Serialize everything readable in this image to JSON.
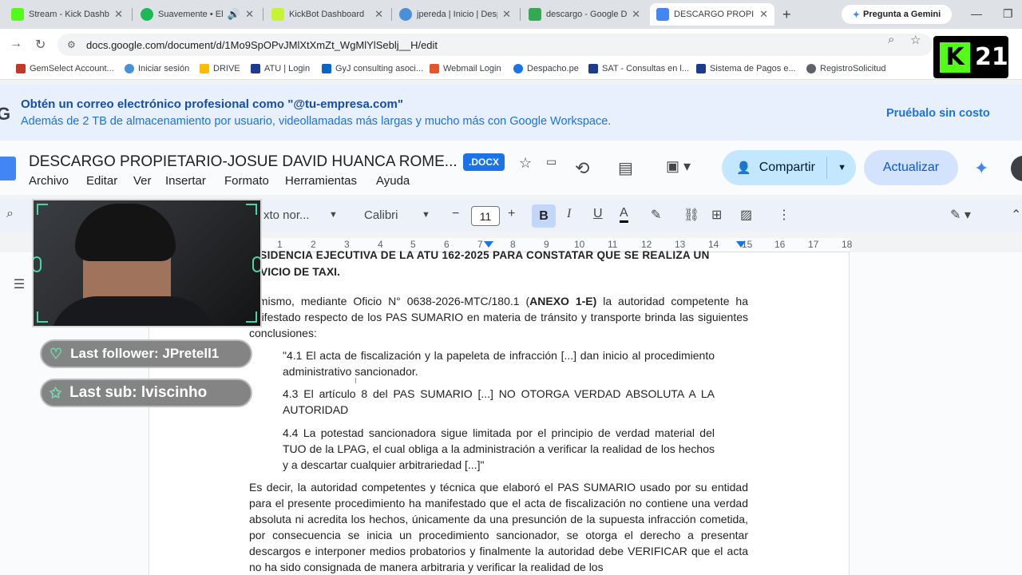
{
  "browser": {
    "tabs": [
      {
        "title": "Stream - Kick Dashbo",
        "icon": "kick-icon",
        "color": "#53fc18"
      },
      {
        "title": "Suavemente • Elv",
        "icon": "spotify-icon",
        "color": "#1db954"
      },
      {
        "title": "KickBot Dashboard",
        "icon": "kickbot-icon",
        "color": "#c6f432"
      },
      {
        "title": "jpereda | Inicio | Desp",
        "icon": "globe-icon",
        "color": "#4a90d9"
      },
      {
        "title": "descargo - Google D",
        "icon": "drive-icon",
        "color": "#34a853"
      },
      {
        "title": "DESCARGO PROPIET",
        "icon": "docs-icon",
        "color": "#4285f4"
      }
    ],
    "gemini_button": "Pregunta a Gemini",
    "url": "docs.google.com/document/d/1Mo9SpOPvJMlXtXmZt_WgMlYlSeblj__H/edit",
    "bookmarks": [
      "GemSelect Account...",
      "Iniciar sesión",
      "DRIVE",
      "ATU | Login",
      "GyJ consulting asoci...",
      "Webmail Login",
      "Despacho.pe",
      "SAT - Consultas en l...",
      "Sistema de Pagos e...",
      "RegistroSolicitud"
    ]
  },
  "promo": {
    "title": "Obtén un correo electrónico profesional como \"@tu-empresa.com\"",
    "subtitle": "Además de 2 TB de almacenamiento por usuario, videollamadas más largas y mucho más con Google Workspace.",
    "cta": "Pruébalo sin costo"
  },
  "docs": {
    "title": "DESCARGO PROPIETARIO-JOSUE DAVID HUANCA ROME...",
    "badge": ".DOCX",
    "menu": [
      "Archivo",
      "Editar",
      "Ver",
      "Insertar",
      "Formato",
      "Herramientas",
      "Ayuda"
    ],
    "share_label": "Compartir",
    "update_label": "Actualizar",
    "toolbar": {
      "style": "xto nor...",
      "font": "Calibri",
      "font_size": "11"
    },
    "ruler": [
      "1",
      "2",
      "3",
      "4",
      "5",
      "6",
      "7",
      "8",
      "9",
      "10",
      "11",
      "12",
      "13",
      "14",
      "15",
      "16",
      "17",
      "18"
    ]
  },
  "document": {
    "heading_line1": "ESIDENCIA EJECUTIVA DE LA ATU 162-2025 PARA CONSTATAR QUE SE REALIZA UN",
    "heading_line2": "RVICIO DE TAXI.",
    "para1_pre": "í mismo, mediante Oficio N° 0638-2026-MTC/180.1 (",
    "para1_bold": "ANEXO 1-E)",
    "para1_post": " la autoridad competente ha anifestado respecto de los PAS SUMARIO en materia de tránsito y transporte brinda las siguientes conclusiones:",
    "quote1": "\"4.1 El acta de fiscalización y la papeleta de infracción [...] dan inicio al procedimiento administrativo sancionador.",
    "quote2": "4.3 El artículo 8 del PAS SUMARIO [...] NO OTORGA VERDAD ABSOLUTA A LA AUTORIDAD",
    "quote3": "4.4 La potestad sancionadora sigue limitada por el principio de verdad material del TUO de la LPAG, el cual obliga a la administración a verificar la realidad de los hechos y a descartar cualquier arbitrariedad [...]\"",
    "para2": "Es decir, la autoridad competentes y técnica que elaboró el PAS SUMARIO usado por su entidad para el presente procedimiento ha manifestado que el acta de fiscalización no contiene una verdad absoluta ni acredita los hechos, únicamente da una presunción de la supuesta infracción cometida, por consecuencia se inicia un procedimiento sancionador, se otorga el derecho a presentar descargos e interponer medios probatorios y finalmente la autoridad debe VERIFICAR que el acta no ha sido consignada de manera arbitraria y verificar la realidad de los"
  },
  "stream_overlay": {
    "last_follower": "Last follower: JPretell1",
    "last_sub": "Last sub: lviscinho",
    "badge_number": "21"
  }
}
